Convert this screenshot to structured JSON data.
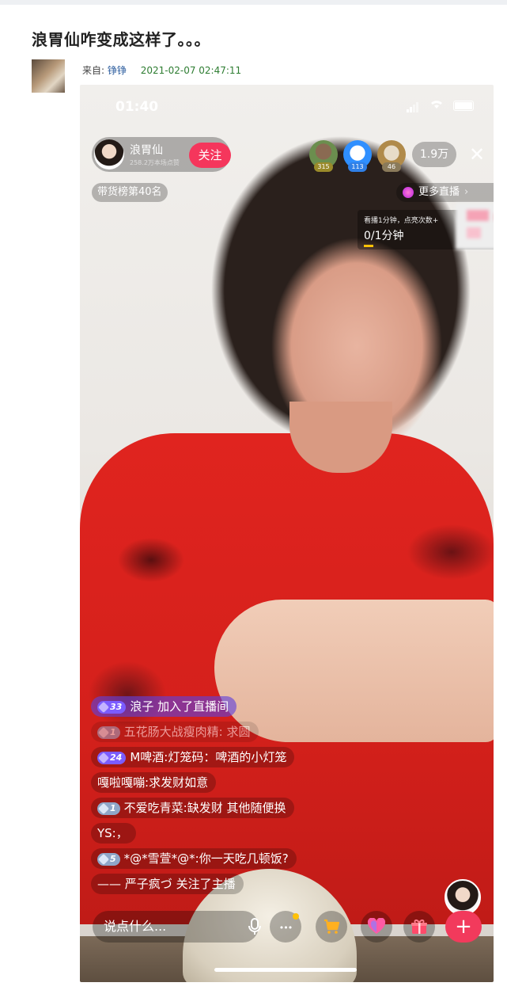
{
  "post": {
    "title": "浪胃仙咋变成这样了。。。",
    "from_label": "来自:",
    "author": "铮铮",
    "date": "2021-02-07 02:47:11"
  },
  "status": {
    "time": "01:40"
  },
  "live": {
    "host_name": "浪胃仙",
    "host_sub": "258.2万本场点赞",
    "follow_label": "关注",
    "viewers": [
      {
        "badge": "315",
        "color": "#6b8e4e"
      },
      {
        "badge": "113",
        "color": "#2f8fff"
      },
      {
        "badge": "46",
        "color": "#b08a4a"
      }
    ],
    "viewer_count": "1.9万",
    "rank_label": "带货榜第40名",
    "more_live": "更多直播",
    "task_hint": "看播1分钟，点亮次数+",
    "task_progress": "0/1分钟"
  },
  "comments": [
    {
      "level": "33",
      "level_style": "purple",
      "name": "浪子",
      "text": "加入了直播间",
      "style": "join"
    },
    {
      "level": "1",
      "level_style": "gray",
      "name": "五花肠大战瘦肉精:",
      "text": "求圆",
      "style": "fade"
    },
    {
      "level": "24",
      "level_style": "purple",
      "name": "M啤酒:",
      "text": "灯笼码：啤酒的小灯笼",
      "style": "normal"
    },
    {
      "level": "",
      "level_style": "",
      "name": "嘎啦嘎嘣:",
      "text": "求发财如意",
      "style": "normal"
    },
    {
      "level": "1",
      "level_style": "gray",
      "name": "不爱吃青菜:",
      "text": "缺发财 其他随便换",
      "style": "normal"
    },
    {
      "level": "",
      "level_style": "",
      "name": "YS:",
      "text": "，",
      "style": "normal"
    },
    {
      "level": "5",
      "level_style": "gray",
      "name": "*@*雪萱*@*:",
      "text": "你一天吃几顿饭?",
      "style": "normal"
    },
    {
      "level": "",
      "level_style": "",
      "name": "—— 严子疯づ",
      "text": "关注了主播",
      "style": "normal"
    }
  ],
  "bottom": {
    "input_placeholder": "说点什么...",
    "more_glyph": "•••",
    "plus_glyph": "+"
  },
  "icons": [
    "mic-icon",
    "more-icon",
    "cart-icon",
    "heart-icon",
    "gift-icon",
    "close-icon"
  ]
}
